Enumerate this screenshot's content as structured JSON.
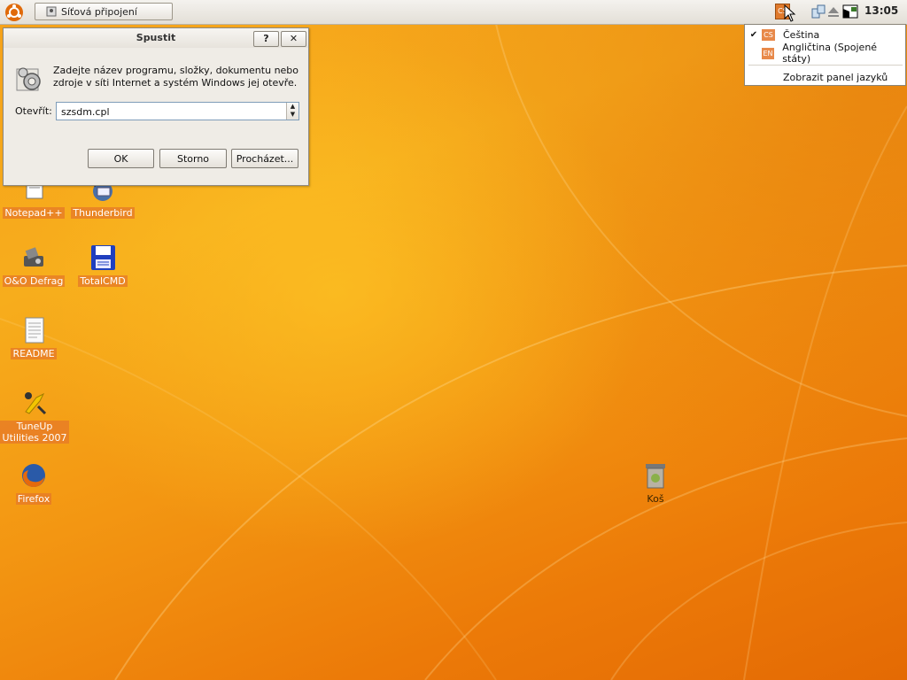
{
  "panel": {
    "task_button": "Síťová připojení",
    "lang_indicator": "CS",
    "clock": "13:05"
  },
  "language_menu": {
    "items": [
      {
        "code": "CS",
        "label": "Čeština",
        "checked": true
      },
      {
        "code": "EN",
        "label": "Angličtina (Spojené státy)",
        "checked": false
      }
    ],
    "show_bar": "Zobrazit panel jazyků"
  },
  "run_dialog": {
    "title": "Spustit",
    "help_btn": "?",
    "close_btn": "✕",
    "description": "Zadejte název programu, složky, dokumentu nebo zdroje v síti Internet a systém Windows jej otevře.",
    "open_label": "Otevřít:",
    "open_value": "szsdm.cpl",
    "ok": "OK",
    "cancel": "Storno",
    "browse": "Procházet..."
  },
  "desktop_icons": {
    "notepad": "Notepad++",
    "thunderbird": "Thunderbird",
    "defrag": "O&O Defrag",
    "totalcmd": "TotalCMD",
    "readme": "README",
    "tuneup": "TuneUp Utilities 2007",
    "firefox": "Firefox",
    "trash": "Koš"
  }
}
